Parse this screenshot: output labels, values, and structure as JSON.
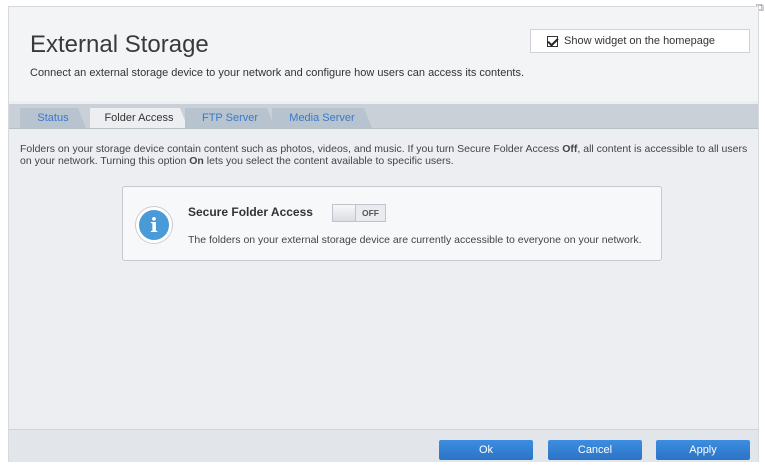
{
  "header": {
    "title": "External Storage",
    "subtitle": "Connect an external storage device to your network and configure how users can access its contents.",
    "widget_checkbox": {
      "label": "Show widget on the homepage",
      "checked": true
    }
  },
  "tabs": [
    {
      "label": "Status",
      "active": false
    },
    {
      "label": "Folder Access",
      "active": true
    },
    {
      "label": "FTP Server",
      "active": false
    },
    {
      "label": "Media Server",
      "active": false
    }
  ],
  "description": {
    "part1": "Folders on your storage device contain content such as photos, videos, and music. If you turn Secure Folder Access ",
    "bold1": "Off",
    "part2": ", all content is accessible to all users on your network. Turning this option ",
    "bold2": "On",
    "part3": " lets you select the content available to specific users."
  },
  "info_card": {
    "icon": "info-icon",
    "heading": "Secure Folder Access",
    "toggle_state": "OFF",
    "text": "The folders on your external storage device are currently accessible to everyone on your network."
  },
  "footer": {
    "ok_label": "Ok",
    "cancel_label": "Cancel",
    "apply_label": "Apply"
  },
  "colors": {
    "accent": "#2f7fd6",
    "tab_link": "#3b78c9",
    "info_icon": "#4a9ad8"
  }
}
